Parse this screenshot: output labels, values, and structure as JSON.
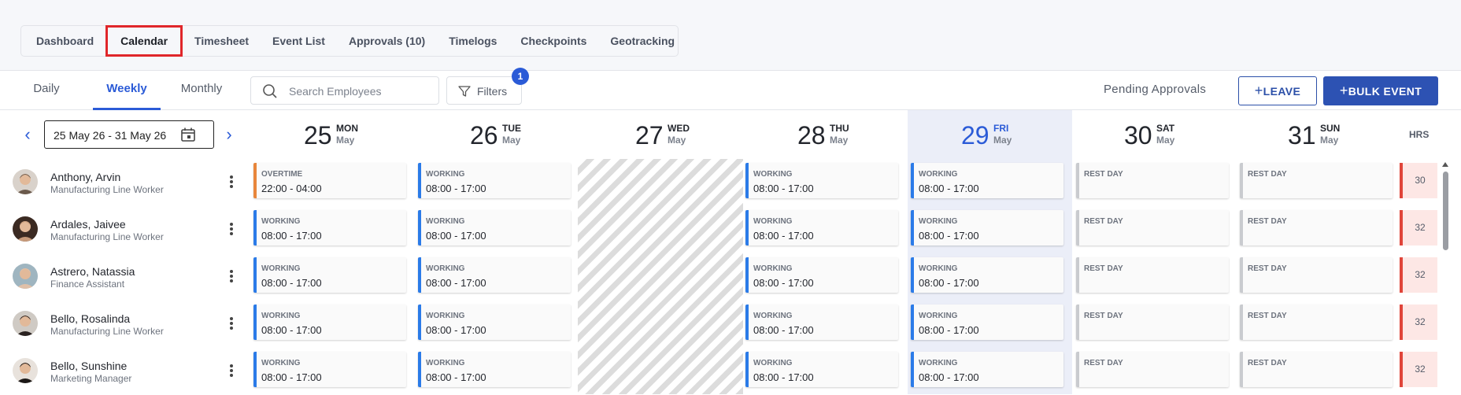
{
  "nav": {
    "tabs": [
      "Dashboard",
      "Calendar",
      "Timesheet",
      "Event List",
      "Approvals (10)",
      "Timelogs",
      "Checkpoints",
      "Geotracking"
    ],
    "active": "Calendar"
  },
  "view_tabs": {
    "daily": "Daily",
    "weekly": "Weekly",
    "monthly": "Monthly",
    "active": "Weekly"
  },
  "search": {
    "placeholder": "Search Employees"
  },
  "filters": {
    "label": "Filters",
    "badge": "1"
  },
  "pending_approvals": "Pending Approvals",
  "buttons": {
    "leave": "LEAVE",
    "bulk_event": "BULK EVENT"
  },
  "date_range": "25 May 26 - 31 May 26",
  "hrs_header": "HRS",
  "days": [
    {
      "num": "25",
      "dow": "MON",
      "month": "May"
    },
    {
      "num": "26",
      "dow": "TUE",
      "month": "May"
    },
    {
      "num": "27",
      "dow": "WED",
      "month": "May"
    },
    {
      "num": "28",
      "dow": "THU",
      "month": "May"
    },
    {
      "num": "29",
      "dow": "FRI",
      "month": "May"
    },
    {
      "num": "30",
      "dow": "SAT",
      "month": "May"
    },
    {
      "num": "31",
      "dow": "SUN",
      "month": "May"
    }
  ],
  "today": "29",
  "colors": {
    "accent": "#2b5bd7",
    "working": "#2b7be8",
    "overtime": "#e8863b",
    "rest": "#c9cbcf",
    "hrs_bar": "#e0453a",
    "highlight": "#e0262a"
  },
  "employees": [
    {
      "name": "Anthony, Arvin",
      "role": "Manufacturing Line Worker",
      "hrs": "30",
      "shifts": [
        {
          "type": "OVERTIME",
          "time": "22:00 - 04:00"
        },
        {
          "type": "WORKING",
          "time": "08:00 - 17:00"
        },
        null,
        {
          "type": "WORKING",
          "time": "08:00 - 17:00"
        },
        {
          "type": "WORKING",
          "time": "08:00 - 17:00"
        },
        {
          "type": "REST DAY",
          "time": ""
        },
        {
          "type": "REST DAY",
          "time": ""
        }
      ]
    },
    {
      "name": "Ardales, Jaivee",
      "role": "Manufacturing Line Worker",
      "hrs": "32",
      "shifts": [
        {
          "type": "WORKING",
          "time": "08:00 - 17:00"
        },
        {
          "type": "WORKING",
          "time": "08:00 - 17:00"
        },
        null,
        {
          "type": "WORKING",
          "time": "08:00 - 17:00"
        },
        {
          "type": "WORKING",
          "time": "08:00 - 17:00"
        },
        {
          "type": "REST DAY",
          "time": ""
        },
        {
          "type": "REST DAY",
          "time": ""
        }
      ]
    },
    {
      "name": "Astrero, Natassia",
      "role": "Finance Assistant",
      "hrs": "32",
      "shifts": [
        {
          "type": "WORKING",
          "time": "08:00 - 17:00"
        },
        {
          "type": "WORKING",
          "time": "08:00 - 17:00"
        },
        null,
        {
          "type": "WORKING",
          "time": "08:00 - 17:00"
        },
        {
          "type": "WORKING",
          "time": "08:00 - 17:00"
        },
        {
          "type": "REST DAY",
          "time": ""
        },
        {
          "type": "REST DAY",
          "time": ""
        }
      ]
    },
    {
      "name": "Bello, Rosalinda",
      "role": "Manufacturing Line Worker",
      "hrs": "32",
      "shifts": [
        {
          "type": "WORKING",
          "time": "08:00 - 17:00"
        },
        {
          "type": "WORKING",
          "time": "08:00 - 17:00"
        },
        null,
        {
          "type": "WORKING",
          "time": "08:00 - 17:00"
        },
        {
          "type": "WORKING",
          "time": "08:00 - 17:00"
        },
        {
          "type": "REST DAY",
          "time": ""
        },
        {
          "type": "REST DAY",
          "time": ""
        }
      ]
    },
    {
      "name": "Bello, Sunshine",
      "role": "Marketing Manager",
      "hrs": "32",
      "shifts": [
        {
          "type": "WORKING",
          "time": "08:00 - 17:00"
        },
        {
          "type": "WORKING",
          "time": "08:00 - 17:00"
        },
        null,
        {
          "type": "WORKING",
          "time": "08:00 - 17:00"
        },
        {
          "type": "WORKING",
          "time": "08:00 - 17:00"
        },
        {
          "type": "REST DAY",
          "time": ""
        },
        {
          "type": "REST DAY",
          "time": ""
        }
      ]
    }
  ]
}
